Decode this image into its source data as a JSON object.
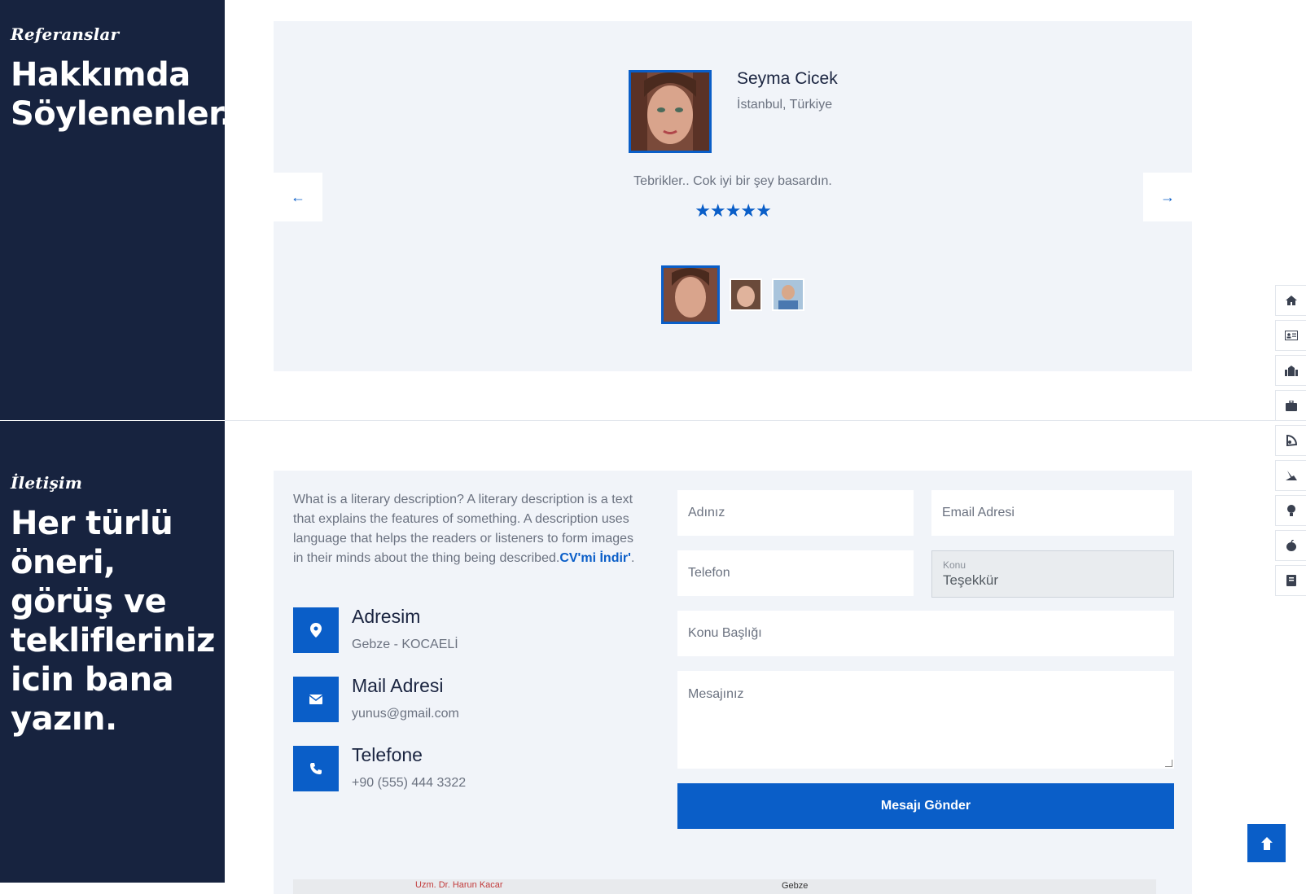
{
  "references": {
    "eyebrow": "Referanslar",
    "title": "Hakkımda Söylenenler..."
  },
  "testimonial": {
    "name": "Seyma Cicek",
    "location": "İstanbul, Türkiye",
    "quote": "Tebrikler.. Cok iyi bir şey basardın.",
    "rating": 5,
    "stars": "★★★★★",
    "prev_icon": "arrow-left-icon",
    "next_icon": "arrow-right-icon",
    "prev_glyph": "←",
    "next_glyph": "→"
  },
  "contact": {
    "eyebrow": "İletişim",
    "title": "Her türlü öneri, görüş ve teklifleriniz icin bana yazın.",
    "description": "What is a literary description? A literary description is a text that explains the features of something. A description uses language that helps the readers or listeners to form images in their minds about the thing being described.",
    "cv_link": "CV'mi İndir'",
    "after_link": ".",
    "items": [
      {
        "title": "Adresim",
        "value": "Gebze - KOCAELİ",
        "icon": "location-pin-icon"
      },
      {
        "title": "Mail Adresi",
        "value": "yunus@gmail.com",
        "icon": "envelope-icon"
      },
      {
        "title": "Telefone",
        "value": "+90 (555) 444 3322",
        "icon": "phone-icon"
      }
    ]
  },
  "form": {
    "name_placeholder": "Adınız",
    "email_placeholder": "Email Adresi",
    "phone_placeholder": "Telefon",
    "subject_label": "Konu",
    "subject_value": "Teşekkür",
    "subject_title_placeholder": "Konu Başlığı",
    "message_placeholder": "Mesajınız",
    "submit_label": "Mesajı Gönder"
  },
  "map": {
    "label_1": "Uzm. Dr. Harun Kacar",
    "label_2": "Gebze"
  },
  "colors": {
    "sidebar": "#17233f",
    "accent": "#0a5ec8",
    "panel": "#f1f4f9"
  },
  "side_nav": [
    "home-icon",
    "id-card-icon",
    "school-icon",
    "briefcase-icon",
    "skills-icon",
    "services-icon",
    "lightbulb-icon",
    "apple-icon",
    "book-icon"
  ],
  "back_to_top_icon": "arrow-up-icon"
}
